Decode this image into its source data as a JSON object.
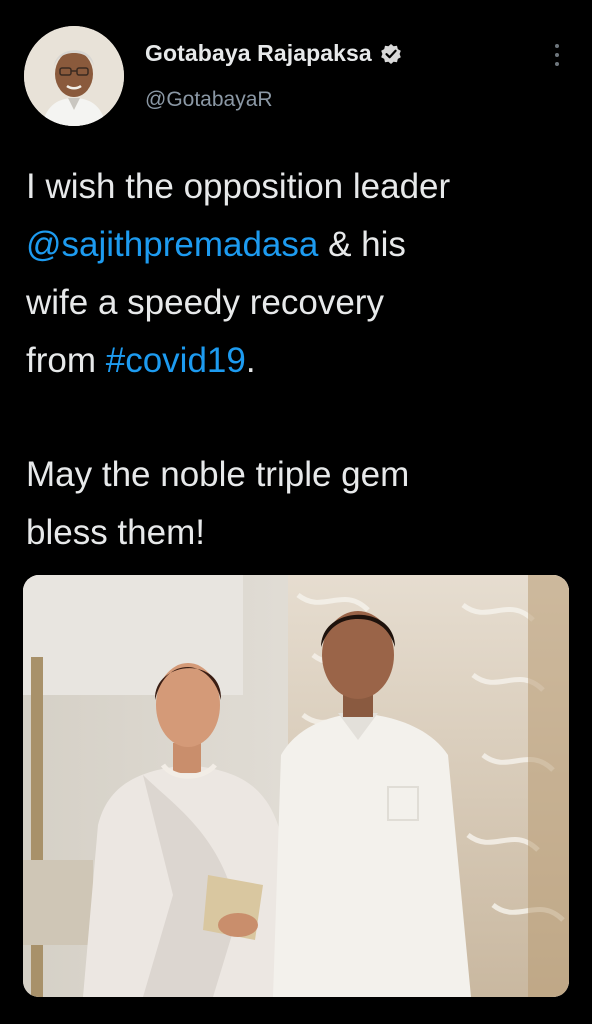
{
  "author": {
    "display_name": "Gotabaya Rajapaksa",
    "handle": "@GotabayaR",
    "verified": true,
    "avatar_icon": "profile-photo"
  },
  "tweet": {
    "line1_a": "I wish the opposition leader",
    "mention": "@sajithpremadasa",
    "line2_b": " & his",
    "line3": "wife a speedy recovery",
    "line4_a": "from ",
    "hashtag": "#covid19",
    "line4_b": ".",
    "line5": "May the noble triple gem",
    "line6": "bless them!"
  },
  "media": {
    "type": "photo",
    "description_icon": "couple-photo"
  },
  "colors": {
    "background": "#000000",
    "text": "#e7e9ea",
    "secondary": "#8b98a5",
    "link": "#1d9bf0"
  }
}
